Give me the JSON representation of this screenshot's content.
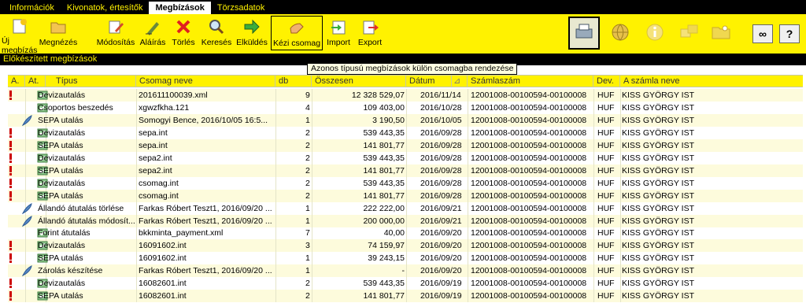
{
  "menu": {
    "tabs": [
      {
        "label": "Információk",
        "active": false
      },
      {
        "label": "Kivonatok, értesítők",
        "active": false
      },
      {
        "label": "Megbízások",
        "active": true
      },
      {
        "label": "Törzsadatok",
        "active": false
      }
    ]
  },
  "toolbar": {
    "buttons": [
      {
        "label": "Új megbízás",
        "icon": "new-order-icon"
      },
      {
        "label": "Megnézés",
        "icon": "folder-open-icon"
      },
      {
        "label": "Módosítás",
        "icon": "edit-pencil-icon"
      },
      {
        "label": "Aláírás",
        "icon": "sign-pen-icon"
      },
      {
        "label": "Törlés",
        "icon": "delete-x-icon"
      },
      {
        "label": "Keresés",
        "icon": "search-icon"
      },
      {
        "label": "Elküldés",
        "icon": "send-arrow-icon"
      },
      {
        "label": "Kézi csomag",
        "icon": "hand-package-icon"
      },
      {
        "label": "Import",
        "icon": "import-icon"
      },
      {
        "label": "Export",
        "icon": "export-icon"
      }
    ],
    "right_buttons": [
      "printer-icon",
      "globe-icon",
      "info-icon",
      "windows-icon",
      "folder-key-icon"
    ],
    "small_buttons": [
      {
        "icon": "link-icon",
        "label": "∞"
      },
      {
        "icon": "help-icon",
        "label": "?"
      }
    ]
  },
  "section_title": "Előkészített megbízások",
  "tooltip": "Azonos típusú megbízások külön csomagba rendezése",
  "table": {
    "columns": [
      "A.",
      "At.",
      "Típus",
      "Csomag neve",
      "db",
      "Összesen",
      "Dátum",
      "Számlaszám",
      "Dev.",
      "A számla neve"
    ],
    "sort_indicator": "⊿",
    "rows": [
      {
        "alert": true,
        "icon": "green",
        "type": "Devizautalás",
        "pkg": "201611100039.xml",
        "db": "9",
        "total": "12 328 529,07",
        "date": "2016/11/14",
        "account": "12001008-00100594-00100008",
        "dev": "HUF",
        "name": "KISS GYÖRGY IST"
      },
      {
        "alert": false,
        "icon": "green",
        "type": "Csoportos beszedés",
        "pkg": "xgwzfkha.121",
        "db": "4",
        "total": "109 403,00",
        "date": "2016/10/28",
        "account": "12001008-00100594-00100008",
        "dev": "HUF",
        "name": "KISS GYÖRGY IST"
      },
      {
        "alert": false,
        "icon": "feather",
        "type": "SEPA utalás",
        "pkg": "Somogyi Bence, 2016/10/05 16:5...",
        "db": "1",
        "total": "3 190,50",
        "date": "2016/10/05",
        "account": "12001008-00100594-00100008",
        "dev": "HUF",
        "name": "KISS GYÖRGY IST"
      },
      {
        "alert": true,
        "icon": "green",
        "type": "Devizautalás",
        "pkg": "sepa.int",
        "db": "2",
        "total": "539 443,35",
        "date": "2016/09/28",
        "account": "12001008-00100594-00100008",
        "dev": "HUF",
        "name": "KISS GYÖRGY IST"
      },
      {
        "alert": true,
        "icon": "green",
        "type": "SEPA utalás",
        "pkg": "sepa.int",
        "db": "2",
        "total": "141 801,77",
        "date": "2016/09/28",
        "account": "12001008-00100594-00100008",
        "dev": "HUF",
        "name": "KISS GYÖRGY IST"
      },
      {
        "alert": true,
        "icon": "green",
        "type": "Devizautalás",
        "pkg": "sepa2.int",
        "db": "2",
        "total": "539 443,35",
        "date": "2016/09/28",
        "account": "12001008-00100594-00100008",
        "dev": "HUF",
        "name": "KISS GYÖRGY IST"
      },
      {
        "alert": true,
        "icon": "green",
        "type": "SEPA utalás",
        "pkg": "sepa2.int",
        "db": "2",
        "total": "141 801,77",
        "date": "2016/09/28",
        "account": "12001008-00100594-00100008",
        "dev": "HUF",
        "name": "KISS GYÖRGY IST"
      },
      {
        "alert": true,
        "icon": "green",
        "type": "Devizautalás",
        "pkg": "csomag.int",
        "db": "2",
        "total": "539 443,35",
        "date": "2016/09/28",
        "account": "12001008-00100594-00100008",
        "dev": "HUF",
        "name": "KISS GYÖRGY IST"
      },
      {
        "alert": true,
        "icon": "green",
        "type": "SEPA utalás",
        "pkg": "csomag.int",
        "db": "2",
        "total": "141 801,77",
        "date": "2016/09/28",
        "account": "12001008-00100594-00100008",
        "dev": "HUF",
        "name": "KISS GYÖRGY IST"
      },
      {
        "alert": false,
        "icon": "feather",
        "type": "Állandó átutalás törlése",
        "pkg": "Farkas Róbert Teszt1, 2016/09/20 ...",
        "db": "1",
        "total": "222 222,00",
        "date": "2016/09/21",
        "account": "12001008-00100594-00100008",
        "dev": "HUF",
        "name": "KISS GYÖRGY IST"
      },
      {
        "alert": false,
        "icon": "feather",
        "type": "Állandó átutalás módosít...",
        "pkg": "Farkas Róbert Teszt1, 2016/09/20 ...",
        "db": "1",
        "total": "200 000,00",
        "date": "2016/09/21",
        "account": "12001008-00100594-00100008",
        "dev": "HUF",
        "name": "KISS GYÖRGY IST"
      },
      {
        "alert": false,
        "icon": "green",
        "type": "Forint átutalás",
        "pkg": "bkkminta_payment.xml",
        "db": "7",
        "total": "40,00",
        "date": "2016/09/20",
        "account": "12001008-00100594-00100008",
        "dev": "HUF",
        "name": "KISS GYÖRGY IST"
      },
      {
        "alert": true,
        "icon": "green",
        "type": "Devizautalás",
        "pkg": "16091602.int",
        "db": "3",
        "total": "74 159,97",
        "date": "2016/09/20",
        "account": "12001008-00100594-00100008",
        "dev": "HUF",
        "name": "KISS GYÖRGY IST"
      },
      {
        "alert": true,
        "icon": "green",
        "type": "SEPA utalás",
        "pkg": "16091602.int",
        "db": "1",
        "total": "39 243,15",
        "date": "2016/09/20",
        "account": "12001008-00100594-00100008",
        "dev": "HUF",
        "name": "KISS GYÖRGY IST"
      },
      {
        "alert": false,
        "icon": "feather",
        "type": "Zárolás készítése",
        "pkg": "Farkas Róbert Teszt1, 2016/09/20 ...",
        "db": "1",
        "total": "-",
        "date": "2016/09/20",
        "account": "12001008-00100594-00100008",
        "dev": "HUF",
        "name": "KISS GYÖRGY IST"
      },
      {
        "alert": true,
        "icon": "green",
        "type": "Devizautalás",
        "pkg": "16082601.int",
        "db": "2",
        "total": "539 443,35",
        "date": "2016/09/19",
        "account": "12001008-00100594-00100008",
        "dev": "HUF",
        "name": "KISS GYÖRGY IST"
      },
      {
        "alert": true,
        "icon": "green",
        "type": "SEPA utalás",
        "pkg": "16082601.int",
        "db": "2",
        "total": "141 801,77",
        "date": "2016/09/19",
        "account": "12001008-00100594-00100008",
        "dev": "HUF",
        "name": "KISS GYÖRGY IST"
      }
    ]
  },
  "colors": {
    "menu_bg": "#000000",
    "accent": "#fff200",
    "alert": "#cc0000",
    "row_alt": "#fdfbdc"
  }
}
